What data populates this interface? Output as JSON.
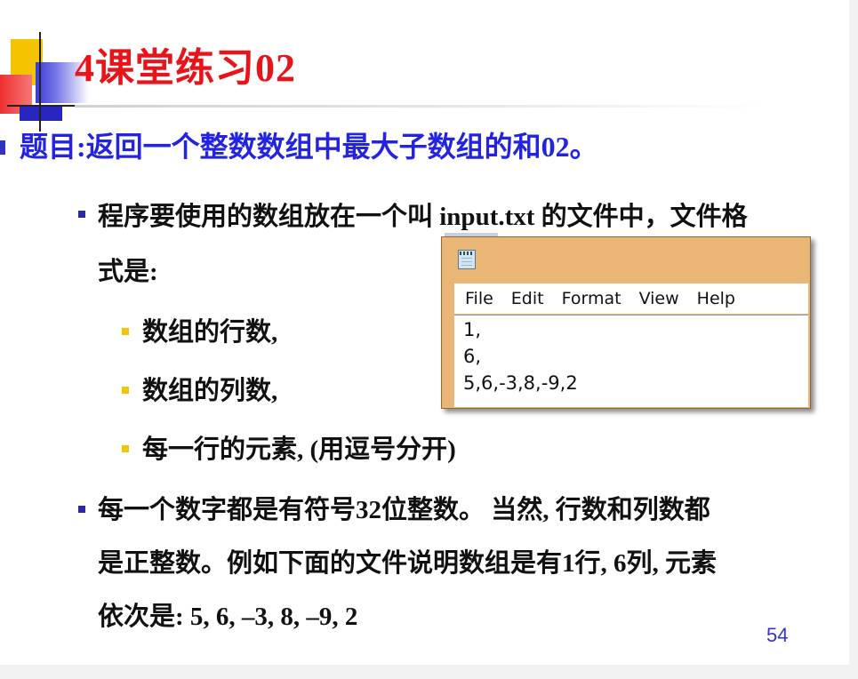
{
  "slide": {
    "title": "4课堂练习02",
    "heading": "题目:返回一个整数数组中最大子数组的和02。",
    "bullet1": {
      "line1": "程序要使用的数组放在一个叫 input.txt 的文件中，文件格",
      "line2": "式是:"
    },
    "sub_bullets": [
      "数组的行数,",
      "数组的列数,",
      "每一行的元素, (用逗号分开)"
    ],
    "bullet2": {
      "line1": "每一个数字都是有符号32位整数。 当然, 行数和列数都",
      "line2": "是正整数。例如下面的文件说明数组是有1行, 6列, 元素",
      "line3": "依次是:  5, 6, –3, 8, –9, 2"
    },
    "page_number": "54"
  },
  "notepad": {
    "icon": "notepad-icon",
    "menu": [
      "File",
      "Edit",
      "Format",
      "View",
      "Help"
    ],
    "content_lines": [
      "1,",
      "6,",
      "5,6,-3,8,-9,2"
    ]
  },
  "colors": {
    "title": "#e8141a",
    "heading": "#2323e0",
    "bullet_blue": "#2a2aa8",
    "bullet_yellow": "#f3c600",
    "notepad_frame": "#eab675",
    "page_number": "#3535c8"
  }
}
